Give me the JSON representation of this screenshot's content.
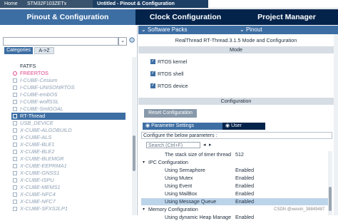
{
  "breadcrumb": [
    "Home",
    "STM32F103ZETx",
    "Untitled - Pinout & Configuration",
    ""
  ],
  "tabs": {
    "pinout": "Pinout & Configuration",
    "clock": "Clock Configuration",
    "project": "Project Manager"
  },
  "subbar": {
    "software_packs": "Software Packs",
    "pinout": "Pinout"
  },
  "left": {
    "search_value": "",
    "categories_label": "Categories",
    "az_label": "A->Z"
  },
  "tree_items": [
    {
      "label": "FATFS",
      "state": "plain"
    },
    {
      "label": "FREERTOS",
      "state": "pink"
    },
    {
      "label": "I-CUBE-Cesium",
      "state": "dim"
    },
    {
      "label": "I-CUBE-UNISONRTOS",
      "state": "dim"
    },
    {
      "label": "I-CUBE-embOS",
      "state": "dim"
    },
    {
      "label": "I-CUBE-wolfSSL",
      "state": "dim"
    },
    {
      "label": "I-CUBE-SmlGOAL",
      "state": "dim"
    },
    {
      "label": "RT-Thread",
      "state": "selected"
    },
    {
      "label": "USB_DEVICE",
      "state": "dim"
    },
    {
      "label": "X-CUBE-ALGOBUILD",
      "state": "dim"
    },
    {
      "label": "X-CUBE-ALS",
      "state": "dim"
    },
    {
      "label": "X-CUBE-BLE1",
      "state": "dim"
    },
    {
      "label": "X-CUBE-BLE2",
      "state": "dim"
    },
    {
      "label": "X-CUBE-BLEMGR",
      "state": "dim"
    },
    {
      "label": "X-CUBE-EEPRMA1",
      "state": "dim"
    },
    {
      "label": "X-CUBE-GNSS1",
      "state": "dim"
    },
    {
      "label": "X-CUBE-ISPU",
      "state": "dim"
    },
    {
      "label": "X-CUBE-MEMS1",
      "state": "dim"
    },
    {
      "label": "X-CUBE-NFC4",
      "state": "dim"
    },
    {
      "label": "X-CUBE-NFC7",
      "state": "dim"
    },
    {
      "label": "X-CUBE-SFXS2LP1",
      "state": "dim"
    }
  ],
  "main": {
    "title": "RealThread RT-Thread.3.1.5 Mode and Configuration",
    "mode_header": "Mode",
    "checkboxes": [
      "RTOS kernel",
      "RTOS shell",
      "RTOS device"
    ],
    "config_header": "Configuration",
    "reset_label": "Reset Configuration",
    "param_tab": "Parameter Settings",
    "const_tab": "User Constants",
    "configure_below": "Configure the below parameters :",
    "search_placeholder": "Search (Ctrl+F)",
    "rows": [
      {
        "key": "The stack size of timer thread",
        "value": "512",
        "type": "param"
      },
      {
        "key": "IPC Configuration",
        "value": "",
        "type": "group"
      },
      {
        "key": "Using Semaphore",
        "value": "Enabled",
        "type": "param"
      },
      {
        "key": "Using Mutex",
        "value": "Enabled",
        "type": "param"
      },
      {
        "key": "Using Event",
        "value": "Enabled",
        "type": "param"
      },
      {
        "key": "Using MailBox",
        "value": "Enabled",
        "type": "param"
      },
      {
        "key": "Using Message Queue",
        "value": "Enabled",
        "type": "highlight"
      },
      {
        "key": "Memory Configuration",
        "value": "",
        "type": "group"
      },
      {
        "key": "Using dynamic Heap Manage",
        "value": "Enabled",
        "type": "param"
      }
    ]
  },
  "watermark": "CSDN @weixin_38849487"
}
